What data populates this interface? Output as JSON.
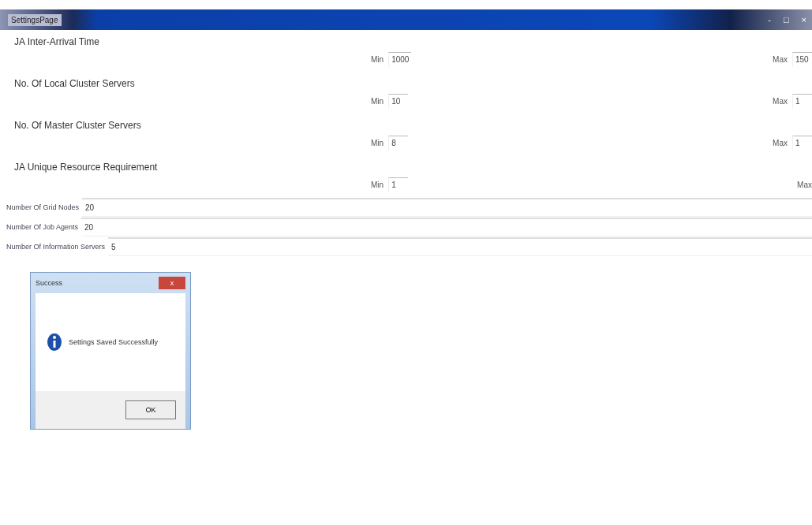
{
  "window": {
    "title": "SettingsPage",
    "controls": [
      "-",
      "□",
      "×"
    ]
  },
  "ranges": [
    {
      "heading": "JA Inter-Arrival Time",
      "min_label": "Min",
      "min_value": "1000",
      "max_label": "Max",
      "max_value": "150"
    },
    {
      "heading": "No. Of Local Cluster Servers",
      "min_label": "Min",
      "min_value": "10",
      "max_label": "Max",
      "max_value": "1"
    },
    {
      "heading": "No. Of Master Cluster Servers",
      "min_label": "Min",
      "min_value": "8",
      "max_label": "Max",
      "max_value": "1"
    },
    {
      "heading": "JA Unique Resource Requirement",
      "min_label": "Min",
      "min_value": "1",
      "max_label": "Max"
    }
  ],
  "fields": [
    {
      "label": "Number Of Grid Nodes",
      "value": "20"
    },
    {
      "label": "Number Of Job Agents",
      "value": "20"
    },
    {
      "label": "Number Of Information Servers",
      "value": "5"
    }
  ],
  "dialog": {
    "title": "Success",
    "close": "x",
    "message": "Settings Saved Successfully",
    "button": "OK"
  }
}
